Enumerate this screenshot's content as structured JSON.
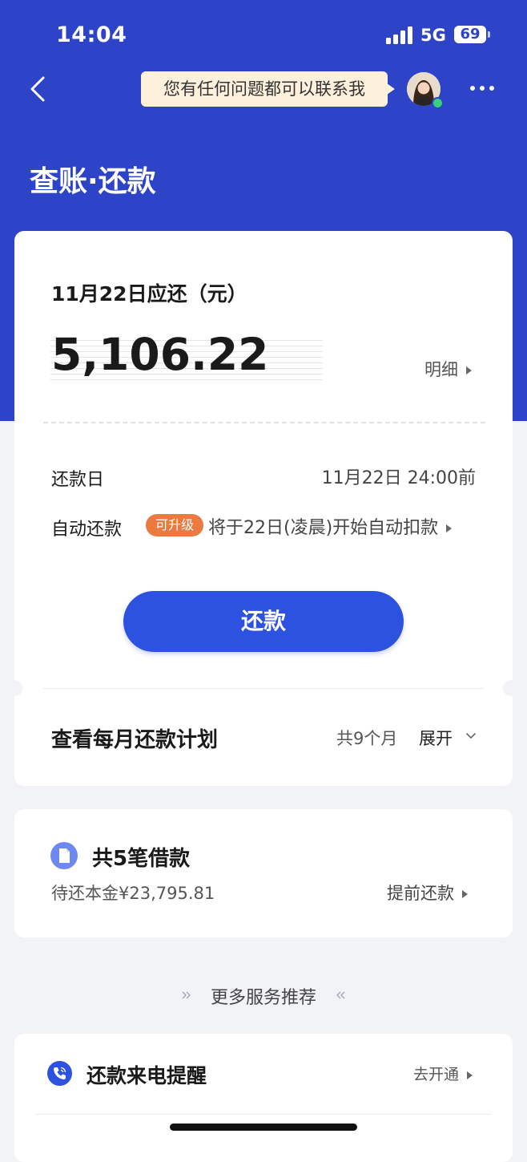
{
  "status_bar": {
    "time": "14:04",
    "network": "5G",
    "battery": "69"
  },
  "nav": {
    "tip": "您有任何问题都可以联系我"
  },
  "page": {
    "title": "查账·还款"
  },
  "bill": {
    "due_label": "11月22日应还（元）",
    "amount": "5,106.22",
    "detail_link": "明细",
    "repay_day_label": "还款日",
    "repay_day_value": "11月22日 24:00前",
    "auto_repay_label": "自动还款",
    "upgrade_badge": "可升级",
    "auto_repay_value": "将于22日(凌晨)开始自动扣款",
    "repay_button": "还款"
  },
  "plan": {
    "title": "查看每月还款计划",
    "months": "共9个月",
    "expand": "展开"
  },
  "loans": {
    "title": "共5笔借款",
    "principal": "待还本金¥23,795.81",
    "prepay_link": "提前还款"
  },
  "services": {
    "title": "更多服务推荐"
  },
  "reminder": {
    "title": "还款来电提醒",
    "enable_link": "去开通"
  },
  "colors": {
    "primary": "#2e44c8",
    "button": "#2e52e0",
    "badge": "#ea7a3f",
    "tip_bg": "#fdf0dc"
  },
  "icons": [
    "back-icon",
    "avatar",
    "more-icon",
    "document-icon",
    "phone-icon",
    "chevron-down-icon"
  ]
}
